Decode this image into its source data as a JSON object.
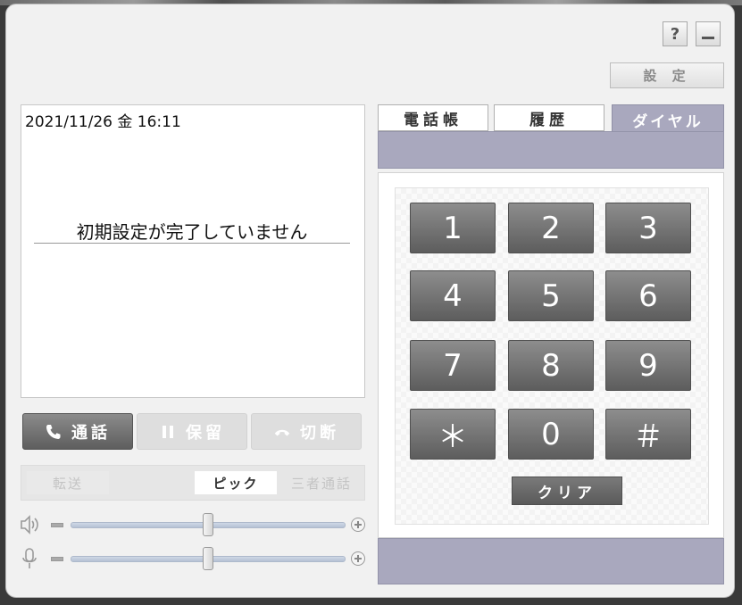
{
  "window_controls": {
    "help_label": "?",
    "minimize_icon": "minimize-icon"
  },
  "settings": {
    "label": "設 定"
  },
  "display": {
    "datetime": "2021/11/26 金 16:11",
    "message": "初期設定が完了していません"
  },
  "controls": {
    "call": {
      "label": "通話",
      "icon": "phone-icon"
    },
    "hold": {
      "label": "保留",
      "icon": "pause-icon"
    },
    "hangup": {
      "label": "切断",
      "icon": "hangup-icon"
    }
  },
  "sub_actions": {
    "transfer": "転送",
    "pick": "ピック",
    "threeway": "三者通話"
  },
  "volume": {
    "speaker": {
      "icon": "speaker-icon",
      "level": 0.5
    },
    "mic": {
      "icon": "mic-icon",
      "level": 0.5
    }
  },
  "tabs": [
    {
      "label": "電話帳"
    },
    {
      "label": "履歴"
    },
    {
      "label": "ダイヤル",
      "active": true
    }
  ],
  "keypad": {
    "keys": [
      "1",
      "2",
      "3",
      "4",
      "5",
      "6",
      "7",
      "8",
      "9",
      "＊",
      "0",
      "＃"
    ],
    "clear_label": "クリア"
  },
  "colors": {
    "accent": "#a9a8be",
    "key": "#6f6f6f"
  }
}
